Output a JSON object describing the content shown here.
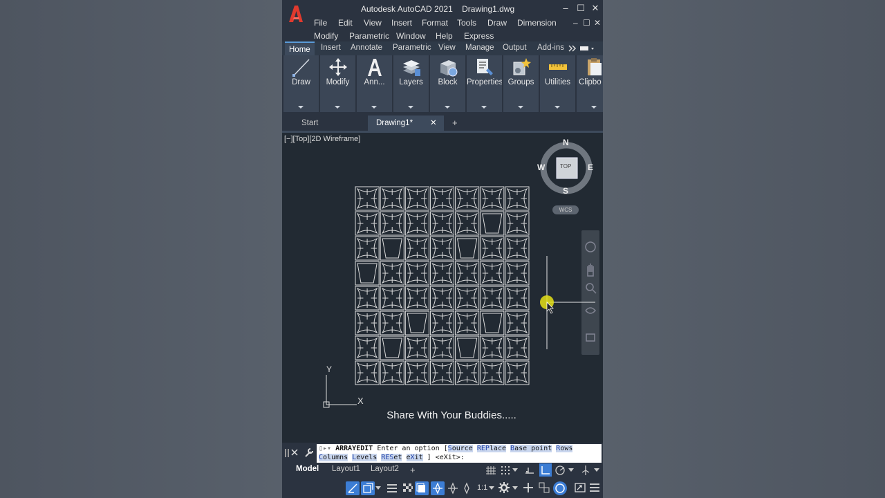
{
  "window": {
    "title_app": "Autodesk AutoCAD 2021",
    "title_doc": "Drawing1.dwg",
    "min_glyph": "–",
    "max_glyph": "☐",
    "close_glyph": "✕"
  },
  "menubar": {
    "row1": [
      "File",
      "Edit",
      "View",
      "Insert",
      "Format",
      "Tools",
      "Draw",
      "Dimension"
    ],
    "row2": [
      "Modify",
      "Parametric",
      "Window",
      "Help",
      "Express"
    ]
  },
  "ribbon_tabs": [
    "Home",
    "Insert",
    "Annotate",
    "Parametric",
    "View",
    "Manage",
    "Output",
    "Add-ins"
  ],
  "ribbon_panels": [
    {
      "label": "Draw",
      "icon": "line-icon"
    },
    {
      "label": "Modify",
      "icon": "move-icon"
    },
    {
      "label": "Ann...",
      "icon": "text-icon"
    },
    {
      "label": "Layers",
      "icon": "layers-icon"
    },
    {
      "label": "Block",
      "icon": "block-icon"
    },
    {
      "label": "Properties",
      "icon": "properties-icon"
    },
    {
      "label": "Groups",
      "icon": "groups-icon"
    },
    {
      "label": "Utilities",
      "icon": "ruler-icon"
    },
    {
      "label": "Clipbo",
      "icon": "clipboard-icon"
    }
  ],
  "file_tabs": {
    "start": "Start",
    "drawing": "Drawing1*",
    "close_glyph": "✕",
    "add_glyph": "+"
  },
  "viewport": {
    "label": "[−][Top][2D Wireframe]",
    "viewcube": {
      "n": "N",
      "s": "S",
      "e": "E",
      "w": "W",
      "top": "TOP",
      "wcs": "WCS"
    },
    "ucs": {
      "x": "X",
      "y": "Y"
    },
    "array": {
      "rows": 8,
      "cols": 7,
      "accent_cells": [
        [
          1,
          5
        ],
        [
          2,
          1
        ],
        [
          2,
          4
        ],
        [
          3,
          0
        ],
        [
          5,
          2
        ],
        [
          5,
          5
        ],
        [
          6,
          1
        ],
        [
          6,
          4
        ]
      ]
    },
    "caption": "Share With Your Buddies....."
  },
  "command_line": {
    "command": "ARRAYEDIT",
    "prompt": "Enter an option [",
    "opt_source_hl": "S",
    "opt_source_rest": "ource",
    "opt_replace_hl": "REP",
    "opt_replace_rest": "lace",
    "opt_basepoint_hl": "B",
    "opt_basepoint_rest": "ase point",
    "opt_rows_hl": "R",
    "opt_rows_rest": "ows",
    "opt_columns_hl": "C",
    "opt_columns_rest": "olumns",
    "opt_levels_hl": "L",
    "opt_levels_rest": "evels",
    "opt_reset_hl": "RES",
    "opt_reset_rest": "et",
    "opt_exit_pre": "e",
    "opt_exit_hl": "X",
    "opt_exit_rest": "it",
    "tail": "] <eXit>:"
  },
  "layout_tabs": [
    "Model",
    "Layout1",
    "Layout2"
  ],
  "layout_add": "+",
  "statusbar": {
    "scale": "1:1"
  }
}
